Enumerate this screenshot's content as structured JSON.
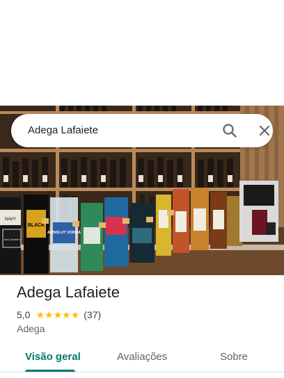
{
  "search": {
    "query": "Adega Lafaiete"
  },
  "icons": {
    "search": "search-icon",
    "close": "close-icon"
  },
  "place": {
    "name": "Adega Lafaiete",
    "rating": "5,0",
    "stars": 5,
    "review_count": "(37)",
    "category": "Adega"
  },
  "photo": {
    "labels": {
      "jack": "Jack Daniel's",
      "black": "BLACK",
      "absolut": "ABSOLUT VODKA",
      "navy": "NAVY"
    }
  },
  "tabs": [
    {
      "label": "Visão geral",
      "active": true
    },
    {
      "label": "Avaliações",
      "active": false
    },
    {
      "label": "Sobre",
      "active": false
    }
  ],
  "colors": {
    "accent": "#00796b",
    "star": "#fbbc04"
  }
}
